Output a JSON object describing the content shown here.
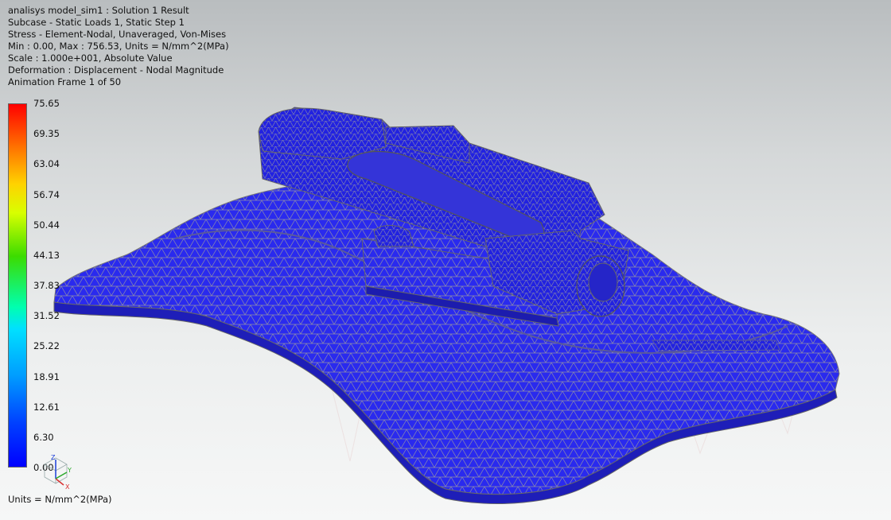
{
  "header": {
    "lines": [
      "analisys model_sim1 : Solution 1 Result",
      "Subcase - Static Loads 1, Static Step 1",
      "Stress - Element-Nodal, Unaveraged, Von-Mises",
      "Min : 0.00, Max : 756.53, Units = N/mm^2(MPa)",
      "Scale :  1.000e+001, Absolute Value",
      "Deformation : Displacement - Nodal Magnitude",
      "Animation Frame 1 of 50"
    ]
  },
  "legend": {
    "ticks": [
      "75.65",
      "69.35",
      "63.04",
      "56.74",
      "50.44",
      "44.13",
      "37.83",
      "31.52",
      "25.22",
      "18.91",
      "12.61",
      "6.30",
      "0.00"
    ],
    "units": "Units = N/mm^2(MPa)"
  },
  "triad": {
    "x_label": "X",
    "y_label": "Y",
    "z_label": "Z"
  },
  "colors": {
    "mesh_fill": "#2a2aee",
    "mesh_lines": "#8c8ca8",
    "background_top": "#b9bdbf",
    "background_bottom": "#f6f7f7"
  }
}
